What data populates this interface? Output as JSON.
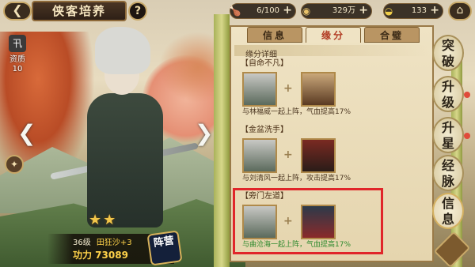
{
  "header": {
    "back_glyph": "❮",
    "title": "侠客培养",
    "help_label": "?",
    "home_glyph": "⌂"
  },
  "resources": [
    {
      "name": "chicken-leg-icon",
      "glyph": "🍗",
      "value": "6/100",
      "plus": "+"
    },
    {
      "name": "coin-icon",
      "glyph": "◉",
      "value": "329万",
      "plus": "+"
    },
    {
      "name": "gold-ingot-icon",
      "glyph": "◒",
      "value": "133",
      "plus": "+"
    }
  ],
  "hero": {
    "aptitude_glyph": "卂",
    "aptitude_label": "资质",
    "aptitude_value": "10",
    "stars": "★★",
    "level": "36级",
    "name": "田狂沙+3",
    "power": "功力 73089",
    "camp": "阵营"
  },
  "nav": {
    "prev_glyph": "❮",
    "next_glyph": "❯"
  },
  "tabs": [
    {
      "label": "信息",
      "active": false
    },
    {
      "label": "缘分",
      "active": true
    },
    {
      "label": "合璧",
      "active": false
    }
  ],
  "section_title": "缘分详细",
  "bonds": [
    {
      "name": "【自命不凡】",
      "plus": "+",
      "desc": "与林福威一起上阵，气血提高17%",
      "active": false
    },
    {
      "name": "【金盆洗手】",
      "plus": "+",
      "desc": "与刘清风一起上阵，攻击提高17%",
      "active": false
    },
    {
      "name": "【旁门左道】",
      "plus": "+",
      "desc": "与曲沧海一起上阵，气血提高17%",
      "active": true
    }
  ],
  "menu": [
    {
      "label": "突破",
      "name": "menu-breakthrough",
      "dot": false
    },
    {
      "label": "升级",
      "name": "menu-upgrade",
      "dot": true
    },
    {
      "label": "升星",
      "name": "menu-star-up",
      "dot": true
    },
    {
      "label": "经脉",
      "name": "menu-meridian",
      "dot": false
    },
    {
      "label": "信息",
      "name": "menu-info",
      "dot": false
    }
  ],
  "colors": {
    "highlight_box": "#e0262a",
    "active_bond_text": "#2e8a2e",
    "active_tab_text": "#b13a22"
  }
}
